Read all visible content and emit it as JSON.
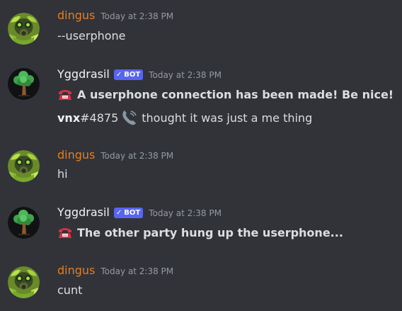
{
  "messages": [
    {
      "author": "dingus",
      "timestamp": "Today at 2:38 PM",
      "avatar": "gasmask-avatar",
      "lines": [
        {
          "text": "--userphone"
        }
      ]
    },
    {
      "author": "Yggdrasil",
      "bot_tag": "BOT",
      "timestamp": "Today at 2:38 PM",
      "avatar": "tree-avatar",
      "lines": [
        {
          "icon": "telephone-icon",
          "text": "A userphone connection has been made! Be nice!"
        },
        {
          "user": "vnx",
          "discriminator": "#4875",
          "icon": "telephone-receiver-icon",
          "text": "thought it was just a me thing"
        }
      ]
    },
    {
      "author": "dingus",
      "timestamp": "Today at 2:38 PM",
      "avatar": "gasmask-avatar",
      "lines": [
        {
          "text": "hi"
        }
      ]
    },
    {
      "author": "Yggdrasil",
      "bot_tag": "BOT",
      "timestamp": "Today at 2:38 PM",
      "avatar": "tree-avatar",
      "lines": [
        {
          "icon": "telephone-icon",
          "text": "The other party hung up the userphone..."
        }
      ]
    },
    {
      "author": "dingus",
      "timestamp": "Today at 2:38 PM",
      "avatar": "gasmask-avatar",
      "lines": [
        {
          "text": "cunt"
        }
      ]
    }
  ],
  "colors": {
    "background": "#313338",
    "dingus_name": "#e67e22",
    "bot_tag": "#5865f2",
    "timestamp": "#949ba4",
    "text": "#dbdee1"
  }
}
